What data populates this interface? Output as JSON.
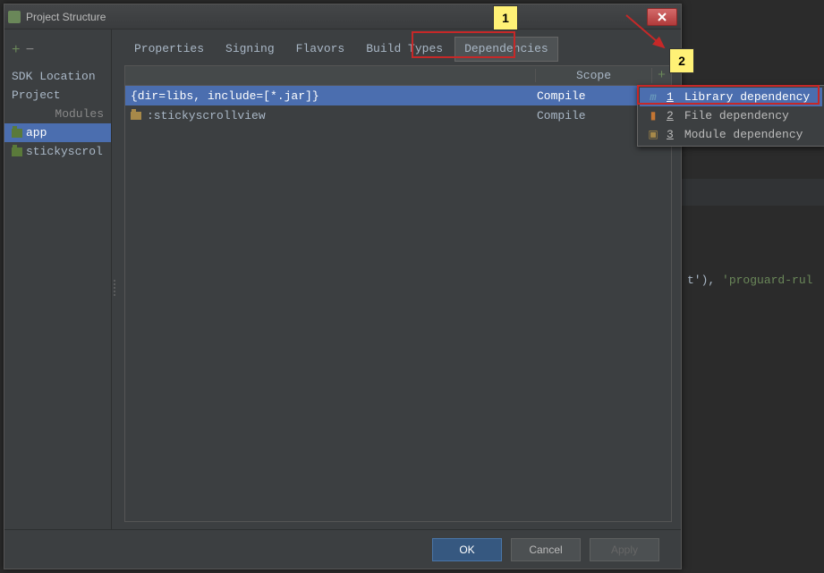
{
  "window": {
    "title": "Project Structure"
  },
  "sidebar": {
    "items": [
      {
        "label": "SDK Location"
      },
      {
        "label": "Project"
      }
    ],
    "modules_heading": "Modules",
    "modules": [
      {
        "label": "app",
        "selected": true
      },
      {
        "label": "stickyscrol"
      }
    ]
  },
  "tabs": [
    {
      "label": "Properties"
    },
    {
      "label": "Signing"
    },
    {
      "label": "Flavors"
    },
    {
      "label": "Build Types"
    },
    {
      "label": "Dependencies",
      "active": true
    }
  ],
  "table": {
    "header_scope": "Scope",
    "rows": [
      {
        "name": "{dir=libs, include=[*.jar]}",
        "scope": "Compile",
        "selected": true
      },
      {
        "name": ":stickyscrollview",
        "scope": "Compile",
        "icon": "folder"
      }
    ]
  },
  "popup": {
    "items": [
      {
        "hotkey": "1",
        "label": "Library dependency",
        "icon": "m",
        "selected": true
      },
      {
        "hotkey": "2",
        "label": "File dependency",
        "icon": "bar"
      },
      {
        "hotkey": "3",
        "label": "Module dependency",
        "icon": "folder"
      }
    ]
  },
  "buttons": {
    "ok": "OK",
    "cancel": "Cancel",
    "apply": "Apply"
  },
  "callouts": {
    "one": "1",
    "two": "2"
  },
  "bg_code": {
    "t": "t'), ",
    "s": "'proguard-rul"
  }
}
